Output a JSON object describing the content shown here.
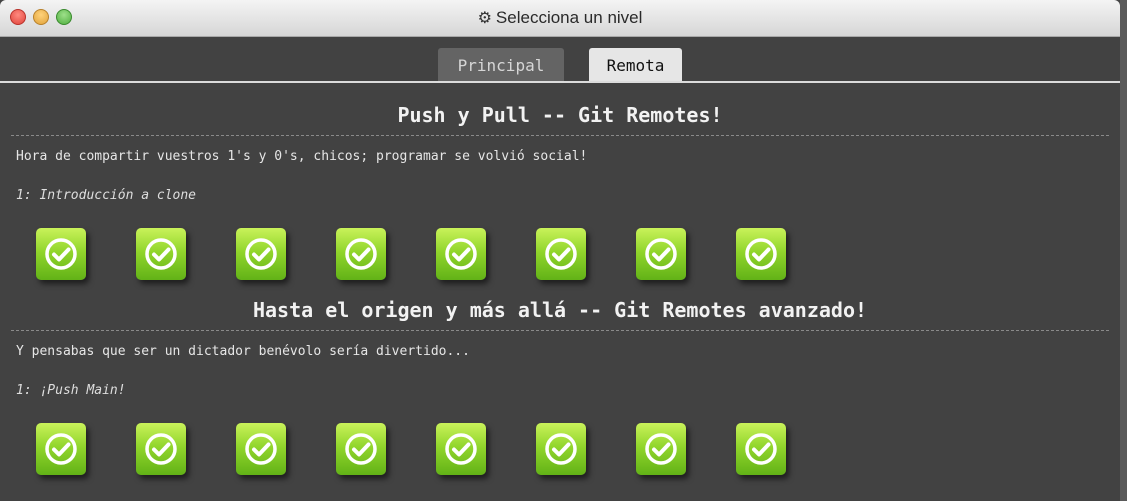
{
  "window": {
    "title": "Selecciona un nivel",
    "title_icon": "gear-icon"
  },
  "tabs": [
    {
      "label": "Principal",
      "active": false
    },
    {
      "label": "Remota",
      "active": true
    }
  ],
  "sections": [
    {
      "title": "Push y Pull -- Git Remotes!",
      "about": "Hora de compartir vuestros 1's y 0's, chicos; programar se volvió social!",
      "level_description": "1: Introducción a clone",
      "levels": [
        {
          "status": "completed"
        },
        {
          "status": "completed"
        },
        {
          "status": "completed"
        },
        {
          "status": "completed"
        },
        {
          "status": "completed"
        },
        {
          "status": "completed"
        },
        {
          "status": "completed"
        },
        {
          "status": "completed"
        }
      ]
    },
    {
      "title": "Hasta el origen y más allá -- Git Remotes avanzado!",
      "about": "Y pensabas que ser un dictador benévolo sería divertido...",
      "level_description": "1: ¡Push Main!",
      "levels": [
        {
          "status": "completed"
        },
        {
          "status": "completed"
        },
        {
          "status": "completed"
        },
        {
          "status": "completed"
        },
        {
          "status": "completed"
        },
        {
          "status": "completed"
        },
        {
          "status": "completed"
        },
        {
          "status": "completed"
        }
      ]
    }
  ],
  "colors": {
    "background": "#424242",
    "icon_green_top": "#c9f25a",
    "icon_green_bottom": "#62b217",
    "active_tab": "#e6e6e6",
    "inactive_tab": "#646464"
  }
}
